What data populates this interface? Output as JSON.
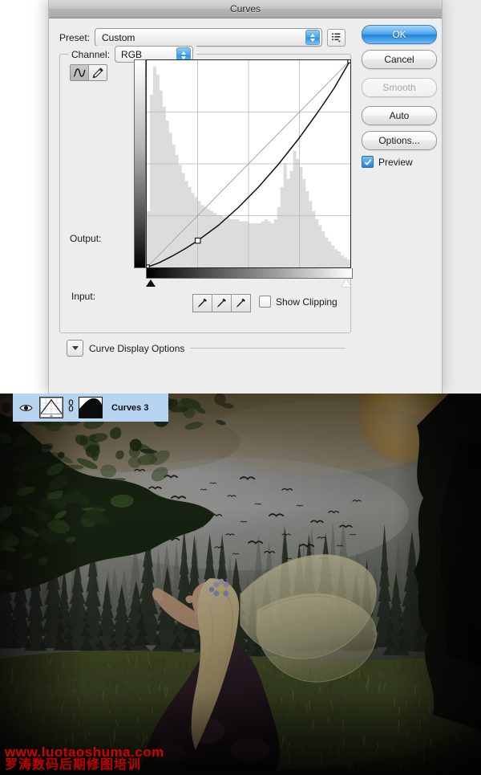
{
  "dialog": {
    "title": "Curves",
    "preset": {
      "label": "Preset:",
      "value": "Custom",
      "menu_icon": "preset-list-icon"
    },
    "channel": {
      "label": "Channel:",
      "value": "RGB"
    },
    "output_label": "Output:",
    "input_label": "Input:",
    "show_clipping": {
      "label": "Show Clipping",
      "checked": false
    },
    "curve_display_options": {
      "label": "Curve Display Options",
      "expanded": false
    },
    "tools": [
      {
        "name": "curve-tool",
        "icon": "curve-icon",
        "selected": true
      },
      {
        "name": "pencil-tool",
        "icon": "pencil-icon",
        "selected": false
      }
    ],
    "eyedroppers": [
      {
        "name": "black-point-eyedropper",
        "icon": "eyedropper-icon"
      },
      {
        "name": "gray-point-eyedropper",
        "icon": "eyedropper-icon"
      },
      {
        "name": "white-point-eyedropper",
        "icon": "eyedropper-icon"
      }
    ],
    "buttons": [
      {
        "label": "OK",
        "style": "primary",
        "enabled": true
      },
      {
        "label": "Cancel",
        "style": "normal",
        "enabled": true
      },
      {
        "label": "Smooth",
        "style": "disabled",
        "enabled": false
      },
      {
        "label": "Auto",
        "style": "normal",
        "enabled": true
      },
      {
        "label": "Options...",
        "style": "normal",
        "enabled": true
      }
    ],
    "preview": {
      "label": "Preview",
      "checked": true
    }
  },
  "chart_data": {
    "type": "line",
    "title": "RGB Tone Curve",
    "xlabel": "Input",
    "ylabel": "Output",
    "xlim": [
      0,
      255
    ],
    "ylim": [
      0,
      255
    ],
    "grid": true,
    "grid_divisions": 4,
    "series": [
      {
        "name": "baseline-diagonal",
        "type": "line",
        "x": [
          0,
          255
        ],
        "y": [
          0,
          255
        ]
      },
      {
        "name": "tone-curve",
        "type": "line",
        "control_points": [
          {
            "input": 0,
            "output": 0
          },
          {
            "input": 64,
            "output": 33
          },
          {
            "input": 255,
            "output": 255
          }
        ],
        "x": [
          0,
          16,
          32,
          48,
          64,
          90,
          115,
          140,
          165,
          190,
          215,
          235,
          255
        ],
        "y": [
          0,
          6,
          14,
          23,
          33,
          52,
          74,
          99,
          127,
          158,
          192,
          221,
          255
        ]
      }
    ],
    "histogram": {
      "name": "rgb-histogram",
      "bins": 64,
      "values": [
        28,
        86,
        100,
        96,
        88,
        80,
        73,
        67,
        61,
        56,
        51,
        47,
        43,
        40,
        37,
        35,
        33,
        31,
        30,
        29,
        28,
        27,
        26,
        26,
        25,
        25,
        24,
        24,
        24,
        23,
        23,
        23,
        22,
        22,
        22,
        22,
        23,
        24,
        23,
        22,
        24,
        30,
        40,
        52,
        44,
        48,
        58,
        54,
        50,
        44,
        38,
        33,
        28,
        24,
        21,
        18,
        15,
        13,
        11,
        9,
        8,
        6,
        5,
        4
      ]
    }
  },
  "layers_panel": {
    "row": {
      "name": "Curves 3",
      "visible": true,
      "eye_icon": "eye-icon",
      "layer_thumb_icon": "curves-thumbnail-icon",
      "link_icon": "link-icon",
      "mask_thumb_icon": "layer-mask-thumbnail-icon"
    }
  },
  "watermark": {
    "line1": "www.luotaoshuma.com",
    "line2": "罗涛数码后期修图培训",
    "color": "#d60000"
  },
  "canvas": {
    "description": "fantasy-fairy-forest-composite",
    "colors": {
      "moon": "#e0b35a",
      "sky_haze": "#b9bcc0",
      "forest_dark": "#1a1f18",
      "grass": "#4e5c2e",
      "wing": "#d8d3a6"
    }
  }
}
